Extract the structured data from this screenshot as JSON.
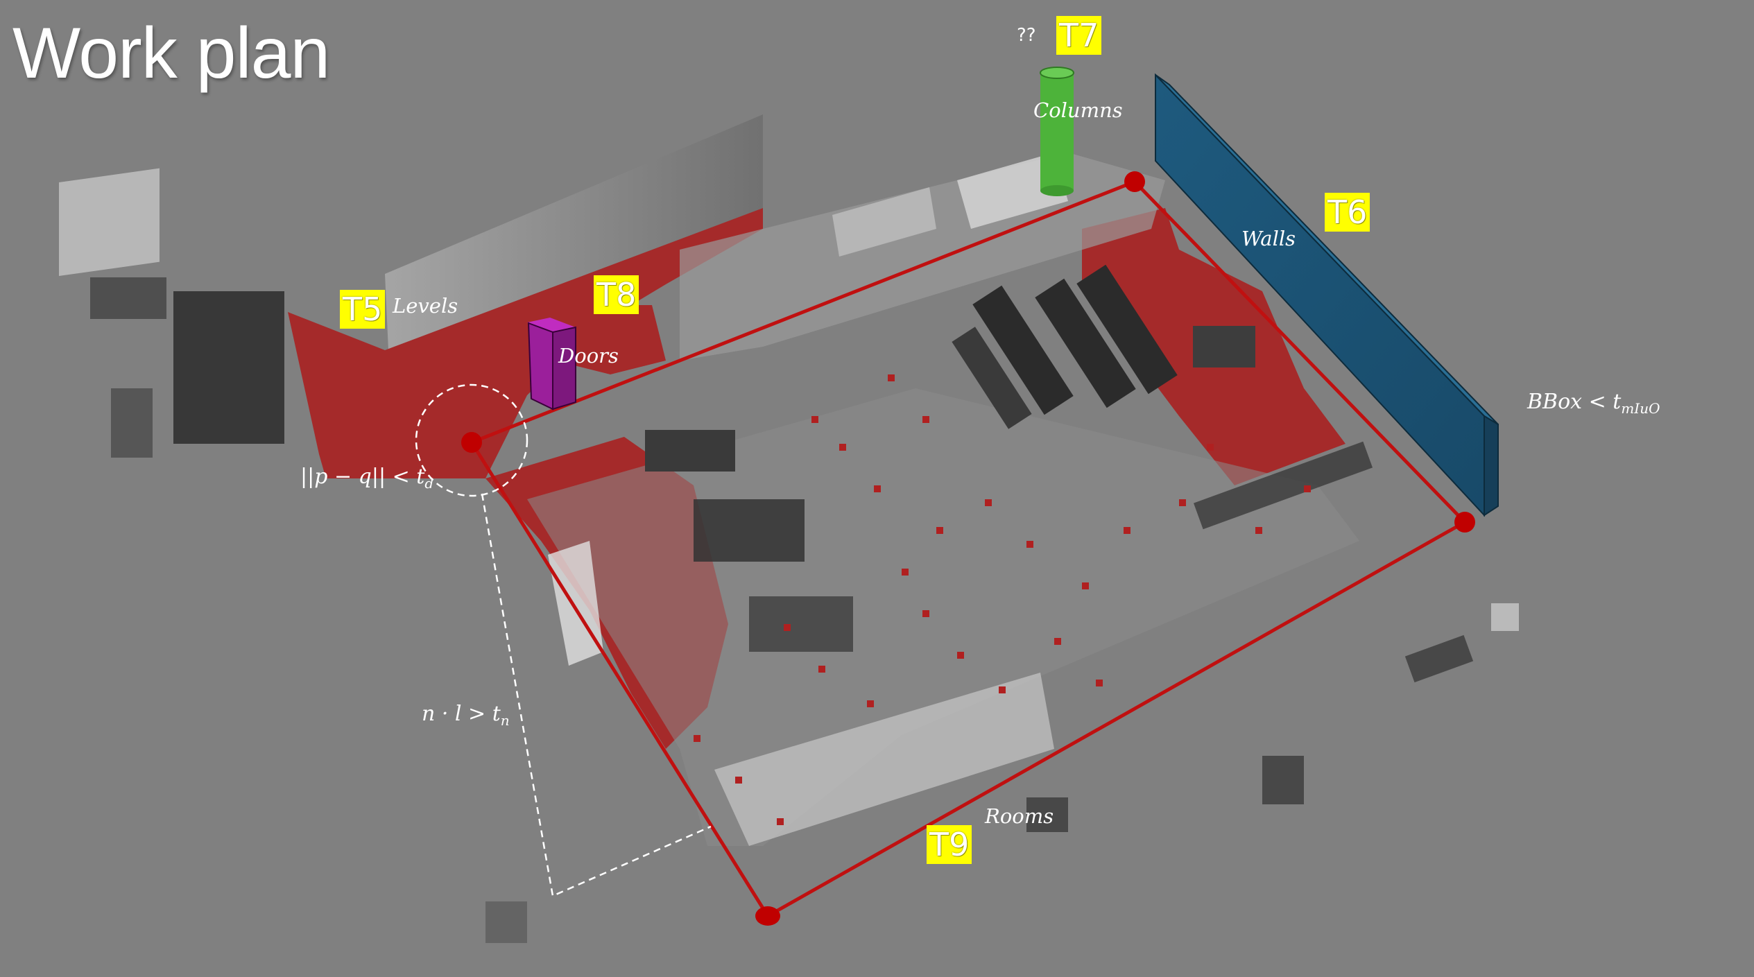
{
  "title": "Work plan",
  "tags": {
    "t5": "T5",
    "t6": "T6",
    "t7": "T7",
    "t8": "T8",
    "t9": "T9"
  },
  "labels": {
    "levels": "Levels",
    "doors": "Doors",
    "columns": "Columns",
    "walls": "Walls",
    "rooms": "Rooms",
    "unknown": "??"
  },
  "formulas": {
    "distance_lhs": "||p − q|| < t",
    "distance_sub": "d",
    "normal_lhs": "n · l > t",
    "normal_sub": "n",
    "bbox_lhs": "BBox < t",
    "bbox_sub": "mIuO"
  },
  "colors": {
    "background": "#808080",
    "floor_red": "#a52a2a",
    "outline_red": "#c01010",
    "wall_blue": "#1f5a7c",
    "column_green": "#4db33a",
    "door_purple": "#9b1f9b",
    "tag_yellow": "#ffff00"
  }
}
